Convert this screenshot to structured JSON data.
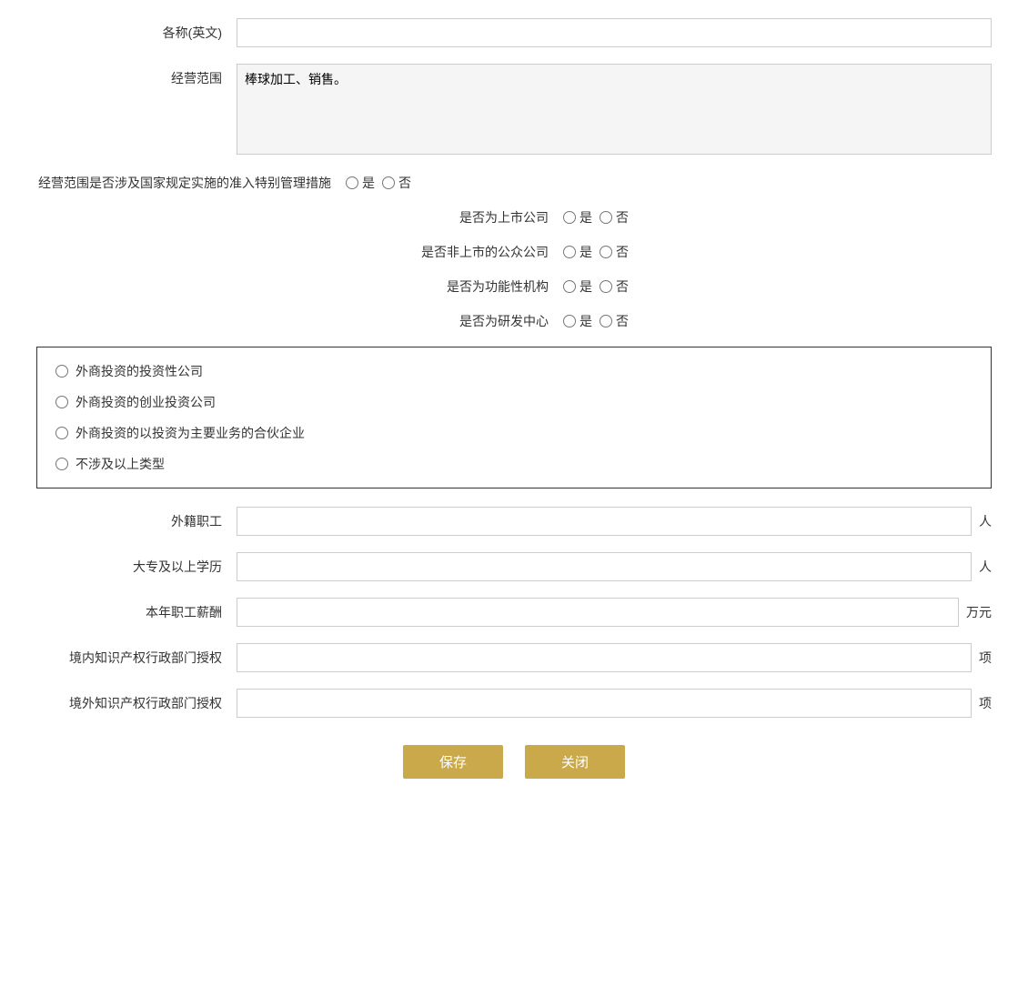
{
  "form": {
    "name_en_label": "各称(英文)",
    "name_en_value": "",
    "name_en_placeholder": "",
    "business_scope_label": "经营范围",
    "business_scope_value": "棒球加工、销售。",
    "special_mgmt_label": "经营范围是否涉及国家规定实施的准入特别管理措施",
    "special_mgmt_yes": "是",
    "special_mgmt_no": "否",
    "listed_label": "是否为上市公司",
    "listed_yes": "是",
    "listed_no": "否",
    "non_listed_public_label": "是否非上市的公众公司",
    "non_listed_public_yes": "是",
    "non_listed_public_no": "否",
    "functional_org_label": "是否为功能性机构",
    "functional_org_yes": "是",
    "functional_org_no": "否",
    "rd_center_label": "是否为研发中心",
    "rd_center_yes": "是",
    "rd_center_no": "否",
    "investment_options": [
      "外商投资的投资性公司",
      "外商投资的创业投资公司",
      "外商投资的以投资为主要业务的合伙企业",
      "不涉及以上类型"
    ],
    "foreign_employees_label": "外籍职工",
    "foreign_employees_value": "",
    "foreign_employees_unit": "人",
    "college_above_label": "大专及以上学历",
    "college_above_value": "",
    "college_above_unit": "人",
    "annual_salary_label": "本年职工薪酬",
    "annual_salary_value": "",
    "annual_salary_unit": "万元",
    "domestic_ip_label": "境内知识产权行政部门授权",
    "domestic_ip_value": "",
    "domestic_ip_unit": "项",
    "foreign_ip_label": "境外知识产权行政部门授权",
    "foreign_ip_value": "",
    "foreign_ip_unit": "项",
    "save_button": "保存",
    "close_button": "关闭"
  }
}
